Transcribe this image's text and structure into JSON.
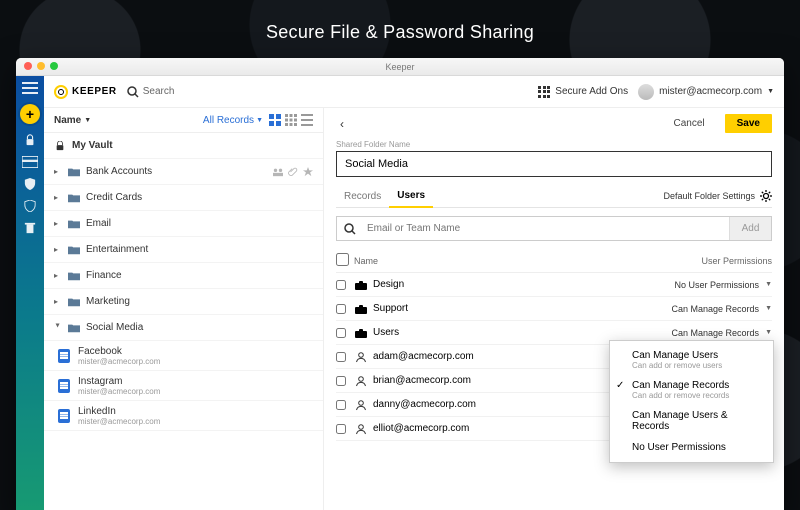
{
  "marketing_tagline": "Secure File & Password Sharing",
  "window_title": "Keeper",
  "brand": "KEEPER",
  "header": {
    "search_placeholder": "Search",
    "secure_addons": "Secure Add Ons",
    "user_email": "mister@acmecorp.com"
  },
  "leftpane": {
    "sort_label": "Name",
    "filter_label": "All Records",
    "vault_label": "My Vault",
    "folders": [
      {
        "label": "Bank Accounts",
        "shared": true
      },
      {
        "label": "Credit Cards"
      },
      {
        "label": "Email"
      },
      {
        "label": "Entertainment"
      },
      {
        "label": "Finance"
      },
      {
        "label": "Marketing"
      }
    ],
    "expanded_folder": "Social Media",
    "records": [
      {
        "title": "Facebook",
        "sub": "mister@acmecorp.com"
      },
      {
        "title": "Instagram",
        "sub": "mister@acmecorp.com"
      },
      {
        "title": "LinkedIn",
        "sub": "mister@acmecorp.com"
      }
    ]
  },
  "rightpane": {
    "cancel": "Cancel",
    "save": "Save",
    "folder_name_label": "Shared Folder Name",
    "folder_name_value": "Social Media",
    "tab_records": "Records",
    "tab_users": "Users",
    "default_settings": "Default Folder Settings",
    "search_placeholder": "Email or Team Name",
    "add_label": "Add",
    "col_name": "Name",
    "col_perm": "User Permissions",
    "rows": [
      {
        "name": "Design",
        "type": "team",
        "perm": "No User Permissions"
      },
      {
        "name": "Support",
        "type": "team",
        "perm": "Can Manage Records"
      },
      {
        "name": "Users",
        "type": "team",
        "perm": "Can Manage Records"
      },
      {
        "name": "adam@acmecorp.com",
        "type": "user",
        "perm": "Can Manage Records"
      },
      {
        "name": "brian@acmecorp.com",
        "type": "user",
        "perm": ""
      },
      {
        "name": "danny@acmecorp.com",
        "type": "user",
        "perm": ""
      },
      {
        "name": "elliot@acmecorp.com",
        "type": "user",
        "perm": ""
      }
    ],
    "dropdown": {
      "opts": [
        {
          "t": "Can Manage Users",
          "s": "Can add or remove users"
        },
        {
          "t": "Can Manage Records",
          "s": "Can add or remove records",
          "sel": true
        },
        {
          "t": "Can Manage Users & Records"
        },
        {
          "t": "No User Permissions"
        }
      ]
    }
  }
}
